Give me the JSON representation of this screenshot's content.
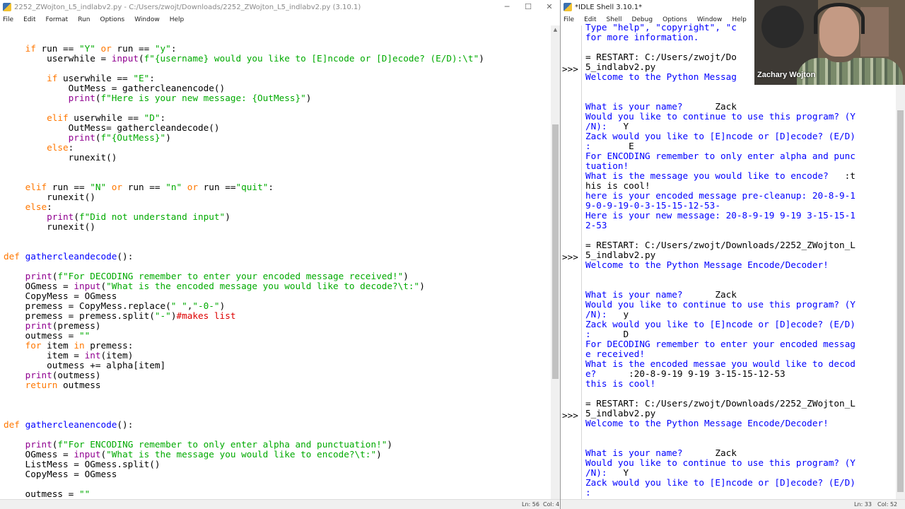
{
  "editor": {
    "title": "2252_ZWojton_L5_indlabv2.py - C:/Users/zwojt/Downloads/2252_ZWojton_L5_indlabv2.py (3.10.1)",
    "menu": [
      "File",
      "Edit",
      "Format",
      "Run",
      "Options",
      "Window",
      "Help"
    ],
    "status": {
      "ln": "Ln: 56",
      "col": "Col: 4"
    }
  },
  "shell": {
    "title": "*IDLE Shell 3.10.1*",
    "menu": [
      "File",
      "Edit",
      "Shell",
      "Debug",
      "Options",
      "Window",
      "Help"
    ],
    "prompt": ">>>",
    "status": {
      "ln": "Ln: 33",
      "col": "Col: 52"
    },
    "lines": [
      {
        "t": "o",
        "s": "Type \"help\", \"copyright\", \"c"
      },
      {
        "t": "o",
        "s": "for more information."
      },
      {
        "t": "p",
        "s": ""
      },
      {
        "t": "r",
        "s": "= RESTART: C:/Users/zwojt/Do"
      },
      {
        "t": "r",
        "s": "5_indlabv2.py"
      },
      {
        "t": "o",
        "s": "Welcome to the Python Messag"
      },
      {
        "t": "o",
        "s": ""
      },
      {
        "t": "o",
        "s": ""
      },
      {
        "t": "o",
        "s": "What is your name?      ",
        "i": "Zack"
      },
      {
        "t": "o",
        "s": "Would you like to continue to use this program? (Y"
      },
      {
        "t": "o",
        "s": "/N):   ",
        "i": "Y"
      },
      {
        "t": "o",
        "s": "Zack would you like to [E]ncode or [D]ecode? (E/D)"
      },
      {
        "t": "o",
        "s": ":       ",
        "i": "E"
      },
      {
        "t": "o",
        "s": "For ENCODING remember to only enter alpha and punc"
      },
      {
        "t": "o",
        "s": "tuation!"
      },
      {
        "t": "o",
        "s": "What is the message you would like to encode?   ",
        "i": ":t"
      },
      {
        "t": "i",
        "s": "his is cool!"
      },
      {
        "t": "o",
        "s": "here is your encoded message pre-cleanup: 20-8-9-1"
      },
      {
        "t": "o",
        "s": "9-0-9-19-0-3-15-15-12-53-"
      },
      {
        "t": "o",
        "s": "Here is your new message: 20-8-9-19 9-19 3-15-15-1"
      },
      {
        "t": "o",
        "s": "2-53"
      },
      {
        "t": "p",
        "s": ""
      },
      {
        "t": "r",
        "s": "= RESTART: C:/Users/zwojt/Downloads/2252_ZWojton_L"
      },
      {
        "t": "r",
        "s": "5_indlabv2.py"
      },
      {
        "t": "o",
        "s": "Welcome to the Python Message Encode/Decoder!"
      },
      {
        "t": "o",
        "s": ""
      },
      {
        "t": "o",
        "s": ""
      },
      {
        "t": "o",
        "s": "What is your name?      ",
        "i": "Zack"
      },
      {
        "t": "o",
        "s": "Would you like to continue to use this program? (Y"
      },
      {
        "t": "o",
        "s": "/N):   ",
        "i": "y"
      },
      {
        "t": "o",
        "s": "Zack would you like to [E]ncode or [D]ecode? (E/D)"
      },
      {
        "t": "o",
        "s": ":      ",
        "i": "D"
      },
      {
        "t": "o",
        "s": "For DECODING remember to enter your encoded messag"
      },
      {
        "t": "o",
        "s": "e received!"
      },
      {
        "t": "o",
        "s": "What is the encoded messae you would like to decod"
      },
      {
        "t": "o",
        "s": "e?      ",
        "i": ":20-8-9-19 9-19 3-15-15-12-53"
      },
      {
        "t": "o",
        "s": "this is cool!"
      },
      {
        "t": "p",
        "s": ""
      },
      {
        "t": "r",
        "s": "= RESTART: C:/Users/zwojt/Downloads/2252_ZWojton_L"
      },
      {
        "t": "r",
        "s": "5_indlabv2.py"
      },
      {
        "t": "o",
        "s": "Welcome to the Python Message Encode/Decoder!"
      },
      {
        "t": "o",
        "s": ""
      },
      {
        "t": "o",
        "s": ""
      },
      {
        "t": "o",
        "s": "What is your name?      ",
        "i": "Zack"
      },
      {
        "t": "o",
        "s": "Would you like to continue to use this program? (Y"
      },
      {
        "t": "o",
        "s": "/N):   ",
        "i": "Y"
      },
      {
        "t": "o",
        "s": "Zack would you like to [E]ncode or [D]ecode? (E/D)"
      },
      {
        "t": "o",
        "s": ":"
      }
    ]
  },
  "webcam": {
    "name": "Zachary Wojton"
  },
  "code_lines": [
    [
      [
        "",
        "    "
      ],
      [
        "kw",
        "if"
      ],
      [
        "",
        " run == "
      ],
      [
        "st",
        "\"Y\""
      ],
      [
        "",
        " "
      ],
      [
        "kw",
        "or"
      ],
      [
        "",
        " run == "
      ],
      [
        "st",
        "\"y\""
      ],
      [
        "",
        ":"
      ]
    ],
    [
      [
        "",
        "        userwhile = "
      ],
      [
        "bi",
        "input"
      ],
      [
        "",
        "("
      ],
      [
        "st",
        "f\"{username} would you like to [E]ncode or [D]ecode? (E/D):\\t\""
      ],
      [
        "",
        ")"
      ]
    ],
    [
      [
        "",
        ""
      ]
    ],
    [
      [
        "",
        "        "
      ],
      [
        "kw",
        "if"
      ],
      [
        "",
        " userwhile == "
      ],
      [
        "st",
        "\"E\""
      ],
      [
        "",
        ":"
      ]
    ],
    [
      [
        "",
        "            OutMess = gathercleanencode()"
      ]
    ],
    [
      [
        "",
        "            "
      ],
      [
        "bi",
        "print"
      ],
      [
        "",
        "("
      ],
      [
        "st",
        "f\"Here is your new message: {OutMess}\""
      ],
      [
        "",
        ")"
      ]
    ],
    [
      [
        "",
        ""
      ]
    ],
    [
      [
        "",
        "        "
      ],
      [
        "kw",
        "elif"
      ],
      [
        "",
        " userwhile == "
      ],
      [
        "st",
        "\"D\""
      ],
      [
        "",
        ":"
      ]
    ],
    [
      [
        "",
        "            OutMess= gathercleandecode()"
      ]
    ],
    [
      [
        "",
        "            "
      ],
      [
        "bi",
        "print"
      ],
      [
        "",
        "("
      ],
      [
        "st",
        "f\"{OutMess}\""
      ],
      [
        "",
        ")"
      ]
    ],
    [
      [
        "",
        "        "
      ],
      [
        "kw",
        "else"
      ],
      [
        "",
        ":"
      ]
    ],
    [
      [
        "",
        "            runexit()"
      ]
    ],
    [
      [
        "",
        ""
      ]
    ],
    [
      [
        "",
        ""
      ]
    ],
    [
      [
        "",
        "    "
      ],
      [
        "kw",
        "elif"
      ],
      [
        "",
        " run == "
      ],
      [
        "st",
        "\"N\""
      ],
      [
        "",
        " "
      ],
      [
        "kw",
        "or"
      ],
      [
        "",
        " run == "
      ],
      [
        "st",
        "\"n\""
      ],
      [
        "",
        " "
      ],
      [
        "kw",
        "or"
      ],
      [
        "",
        " run =="
      ],
      [
        "st",
        "\"quit\""
      ],
      [
        "",
        ":"
      ]
    ],
    [
      [
        "",
        "        runexit()"
      ]
    ],
    [
      [
        "",
        "    "
      ],
      [
        "kw",
        "else"
      ],
      [
        "",
        ":"
      ]
    ],
    [
      [
        "",
        "        "
      ],
      [
        "bi",
        "print"
      ],
      [
        "",
        "("
      ],
      [
        "st",
        "f\"Did not understand input\""
      ],
      [
        "",
        ")"
      ]
    ],
    [
      [
        "",
        "        runexit()"
      ]
    ],
    [
      [
        "",
        ""
      ]
    ],
    [
      [
        "",
        ""
      ]
    ],
    [
      [
        "kw",
        "def"
      ],
      [
        "",
        " "
      ],
      [
        "df",
        "gathercleandecode"
      ],
      [
        "",
        "():"
      ]
    ],
    [
      [
        "",
        ""
      ]
    ],
    [
      [
        "",
        "    "
      ],
      [
        "bi",
        "print"
      ],
      [
        "",
        "("
      ],
      [
        "st",
        "f\"For DECODING remember to enter your encoded message received!\""
      ],
      [
        "",
        ")"
      ]
    ],
    [
      [
        "",
        "    OGmess = "
      ],
      [
        "bi",
        "input"
      ],
      [
        "",
        "("
      ],
      [
        "st",
        "\"What is the encoded message you would like to decode?\\t:\""
      ],
      [
        "",
        ")"
      ]
    ],
    [
      [
        "",
        "    CopyMess = OGmess"
      ]
    ],
    [
      [
        "",
        "    premess = CopyMess.replace("
      ],
      [
        "st",
        "\" \""
      ],
      [
        "",
        ","
      ],
      [
        "st",
        "\"-0-\""
      ],
      [
        "",
        ")"
      ]
    ],
    [
      [
        "",
        "    premess = premess.split("
      ],
      [
        "st",
        "\"-\""
      ],
      [
        "",
        ")"
      ],
      [
        "cm",
        "#makes list"
      ]
    ],
    [
      [
        "",
        "    "
      ],
      [
        "bi",
        "print"
      ],
      [
        "",
        "(premess)"
      ]
    ],
    [
      [
        "",
        "    outmess = "
      ],
      [
        "st",
        "\"\""
      ]
    ],
    [
      [
        "",
        "    "
      ],
      [
        "kw",
        "for"
      ],
      [
        "",
        " item "
      ],
      [
        "kw",
        "in"
      ],
      [
        "",
        " premess:"
      ]
    ],
    [
      [
        "",
        "        item = "
      ],
      [
        "bi",
        "int"
      ],
      [
        "",
        "(item)"
      ]
    ],
    [
      [
        "",
        "        outmess += alpha[item]"
      ]
    ],
    [
      [
        "",
        "    "
      ],
      [
        "bi",
        "print"
      ],
      [
        "",
        "(outmess)"
      ]
    ],
    [
      [
        "",
        "    "
      ],
      [
        "kw",
        "return"
      ],
      [
        "",
        " outmess"
      ]
    ],
    [
      [
        "",
        ""
      ]
    ],
    [
      [
        "",
        ""
      ]
    ],
    [
      [
        "",
        ""
      ]
    ],
    [
      [
        "kw",
        "def"
      ],
      [
        "",
        " "
      ],
      [
        "df",
        "gathercleanencode"
      ],
      [
        "",
        "():"
      ]
    ],
    [
      [
        "",
        ""
      ]
    ],
    [
      [
        "",
        "    "
      ],
      [
        "bi",
        "print"
      ],
      [
        "",
        "("
      ],
      [
        "st",
        "f\"For ENCODING remember to only enter alpha and punctuation!\""
      ],
      [
        "",
        ")"
      ]
    ],
    [
      [
        "",
        "    OGmess = "
      ],
      [
        "bi",
        "input"
      ],
      [
        "",
        "("
      ],
      [
        "st",
        "\"What is the message you would like to encode?\\t:\""
      ],
      [
        "",
        ")"
      ]
    ],
    [
      [
        "",
        "    ListMess = OGmess.split()"
      ]
    ],
    [
      [
        "",
        "    CopyMess = OGmess"
      ]
    ],
    [
      [
        "",
        ""
      ]
    ],
    [
      [
        "",
        "    outmess = "
      ],
      [
        "st",
        "\"\""
      ]
    ]
  ]
}
